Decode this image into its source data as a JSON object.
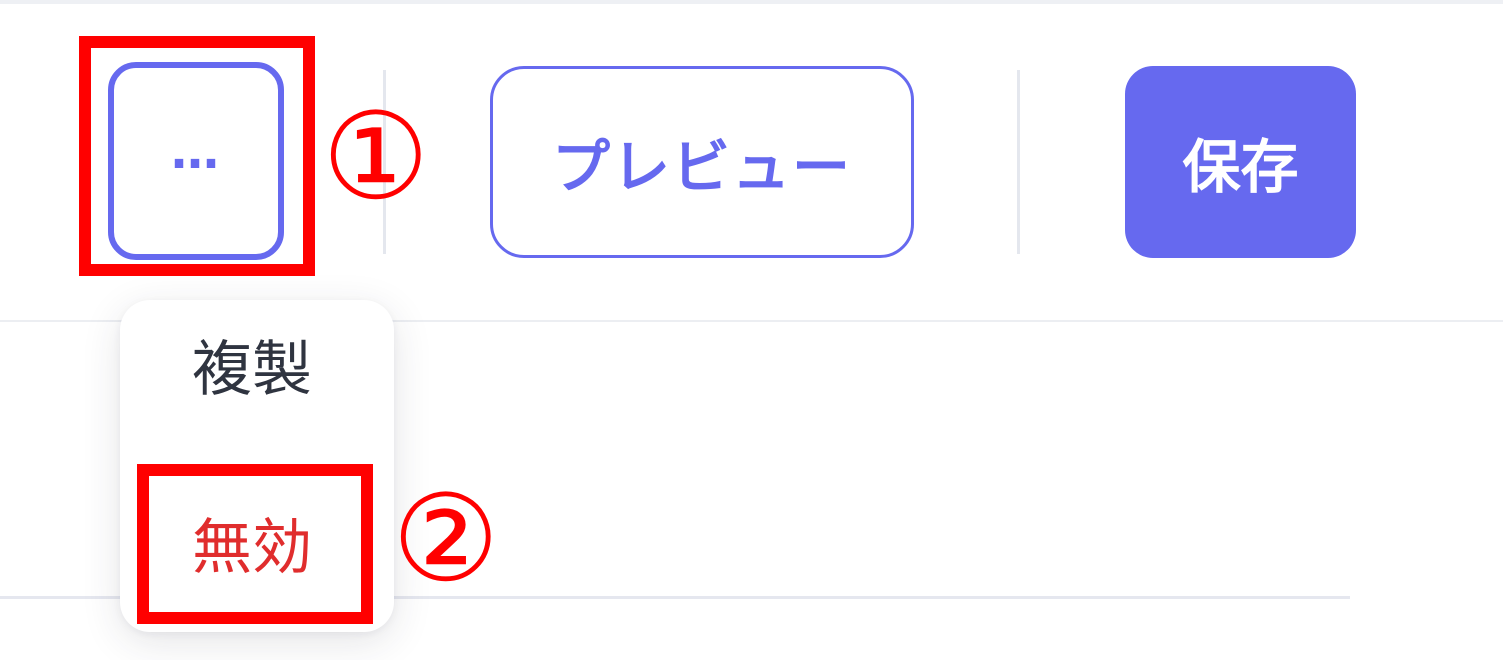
{
  "colors": {
    "accent": "#6669ef",
    "danger": "#e02d2d",
    "annotation": "#ff0000"
  },
  "toolbar": {
    "more_label": "…",
    "preview_label": "プレビュー",
    "save_label": "保存"
  },
  "dropdown": {
    "items": [
      {
        "label": "複製"
      },
      {
        "label": "無効"
      }
    ]
  },
  "annotations": {
    "callout_1": "①",
    "callout_2": "②"
  }
}
